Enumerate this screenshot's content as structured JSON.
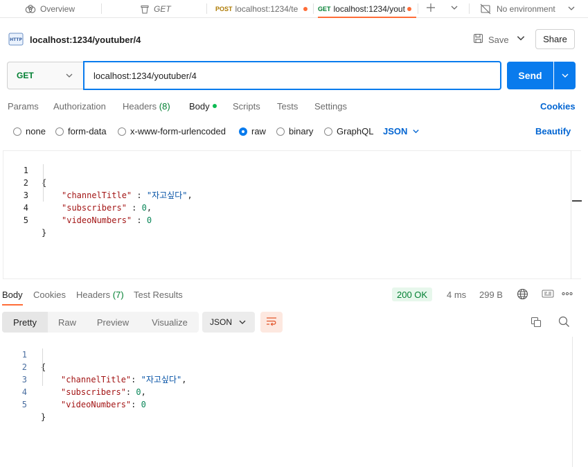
{
  "tabs": [
    {
      "label": "Overview",
      "icon": "overview-icon"
    },
    {
      "label": "GET",
      "icon": "trash-icon"
    },
    {
      "method": "POST",
      "label": "localhost:1234/te"
    },
    {
      "method": "GET",
      "label": "localhost:1234/yout",
      "active": true
    },
    {
      "label": "No environment",
      "icon": "no-environment-icon"
    }
  ],
  "request": {
    "title": "localhost:1234/youtuber/4",
    "save_label": "Save",
    "share_label": "Share",
    "method": "GET",
    "url": "localhost:1234/youtuber/4",
    "send_label": "Send"
  },
  "request_tabs": {
    "params": "Params",
    "authorization": "Authorization",
    "headers": "Headers",
    "headers_count": "(8)",
    "body": "Body",
    "scripts": "Scripts",
    "tests": "Tests",
    "settings": "Settings",
    "cookies": "Cookies"
  },
  "body_types": {
    "none": "none",
    "form_data": "form-data",
    "urlencoded": "x-www-form-urlencoded",
    "raw": "raw",
    "binary": "binary",
    "graphql": "GraphQL",
    "selected": "raw",
    "format": "JSON",
    "beautify": "Beautify"
  },
  "request_body": {
    "line_numbers": [
      "1",
      "2",
      "3",
      "4",
      "5"
    ],
    "open_brace": "{",
    "close_brace": "}",
    "key1": "\"channelTitle\"",
    "val1": "\"자고싶다\"",
    "key2": "\"subscribers\"",
    "val2": "0",
    "key3": "\"videoNumbers\"",
    "val3": "0",
    "sep": " : ",
    "comma": ","
  },
  "response_tabs": {
    "body": "Body",
    "cookies": "Cookies",
    "headers": "Headers",
    "headers_count": "(7)",
    "test_results": "Test Results"
  },
  "response_meta": {
    "status": "200 OK",
    "time": "4 ms",
    "size": "299 B",
    "status_color": "#007f31"
  },
  "response_views": {
    "pretty": "Pretty",
    "raw": "Raw",
    "preview": "Preview",
    "visualize": "Visualize",
    "format": "JSON"
  },
  "response_body": {
    "line_numbers": [
      "1",
      "2",
      "3",
      "4",
      "5"
    ],
    "open_brace": "{",
    "close_brace": "}",
    "key1": "\"channelTitle\"",
    "val1": "\"자고싶다\"",
    "key2": "\"subscribers\"",
    "val2": "0",
    "key3": "\"videoNumbers\"",
    "val3": "0",
    "sep": ": ",
    "comma": ","
  },
  "colors": {
    "accent": "#ff6c37",
    "primary": "#097bed",
    "link": "#0265d2"
  }
}
